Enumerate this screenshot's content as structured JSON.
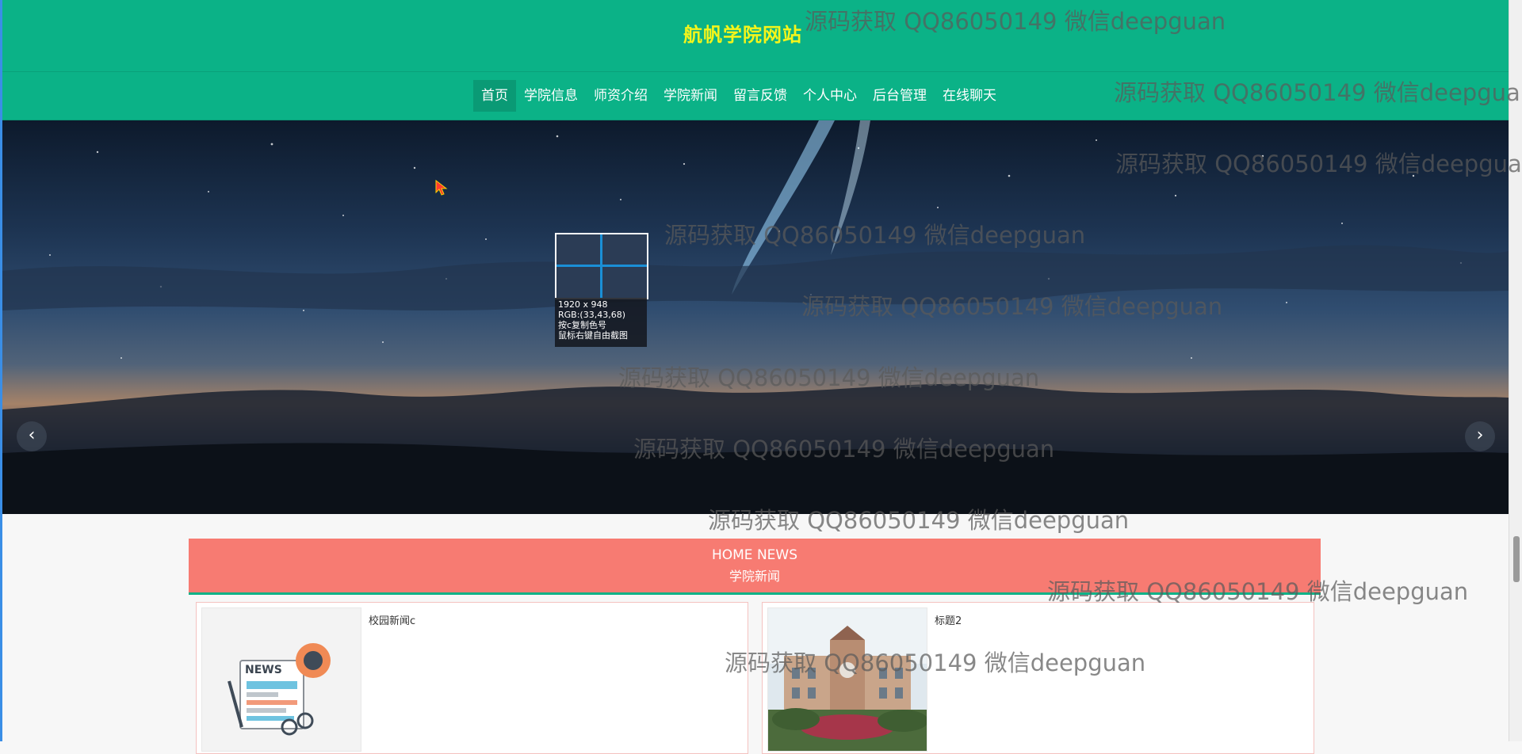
{
  "header": {
    "site_title": "航帆学院网站"
  },
  "nav": {
    "items": [
      {
        "label": "首页",
        "active": true
      },
      {
        "label": "学院信息"
      },
      {
        "label": "师资介绍"
      },
      {
        "label": "学院新闻"
      },
      {
        "label": "留言反馈"
      },
      {
        "label": "个人中心"
      },
      {
        "label": "后台管理"
      },
      {
        "label": "在线聊天"
      }
    ]
  },
  "banner": {
    "prev_icon": "chevron-left-icon",
    "next_icon": "chevron-right-icon"
  },
  "capture_tool": {
    "size_text": "1920 x 948",
    "rgb_text": "RGB:(33,43,68)",
    "copy_hint": "按c复制色号",
    "free_hint": "鼠标右键自由截图"
  },
  "news": {
    "heading_en": "HOME NEWS",
    "heading_cn": "学院新闻",
    "items": [
      {
        "title": "校园新闻c",
        "image": "news-illustration"
      },
      {
        "title": "标题2",
        "image": "campus-building-photo"
      }
    ]
  },
  "watermark": {
    "text": "源码获取 QQ86050149 微信deepguan"
  },
  "colors": {
    "primary": "#0bb287",
    "title_yellow": "#f5f51a",
    "news_head": "#f77b72"
  }
}
